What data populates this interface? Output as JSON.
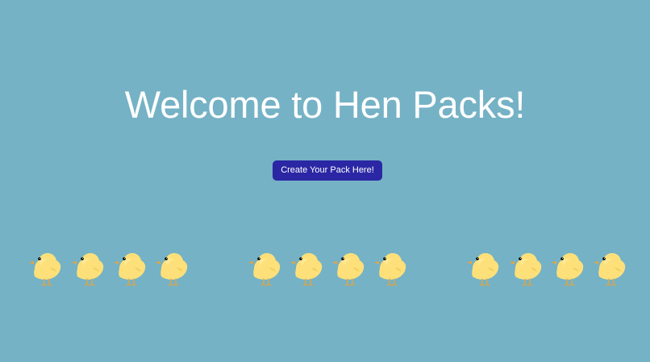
{
  "page": {
    "title": "Welcome to Hen Packs!",
    "background_color": "#75b2c5"
  },
  "cta": {
    "label": "Create Your Pack Here!",
    "color": "#2b27a4"
  },
  "chicks": {
    "icon": "chick-icon",
    "groups": 3,
    "per_group": 4,
    "body_color": "#fde07a",
    "beak_color": "#f0a236"
  }
}
